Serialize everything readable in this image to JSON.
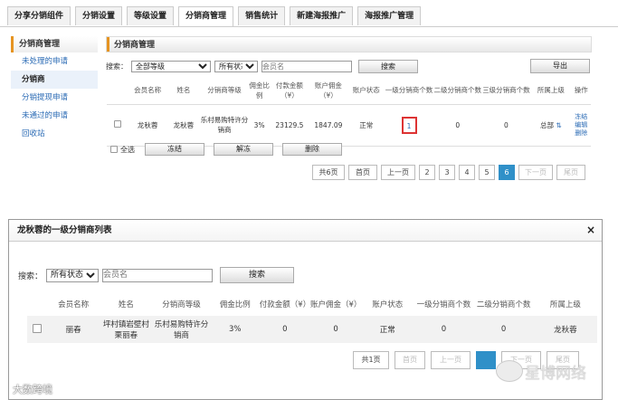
{
  "tabs": [
    "分享分销组件",
    "分销设置",
    "等级设置",
    "分销商管理",
    "销售统计",
    "新建海报推广",
    "海报推广管理"
  ],
  "sidebar": {
    "title": "分销商管理",
    "items": [
      "未处理的申请",
      "分销商",
      "分销提现申请",
      "未通过的申请",
      "回收站"
    ]
  },
  "main": {
    "title": "分销商管理"
  },
  "search": {
    "label": "搜索：",
    "level_value": "全部等级",
    "status_value": "所有状态",
    "member_placeholder": "会员名",
    "search_btn": "搜索",
    "export_btn": "导出"
  },
  "table": {
    "headers": [
      "会员名称",
      "姓名",
      "分销商等级",
      "佣金比例",
      "付款金额（¥）",
      "账户佣金（¥）",
      "账户状态",
      "一级分销商个数",
      "二级分销商个数",
      "三级分销商个数",
      "所属上级",
      "操作"
    ],
    "row": {
      "member": "龙秋蓉",
      "name": "龙秋蓉",
      "level": "乐村易购特许分销商",
      "rate": "3%",
      "pay": "23129.5",
      "commission": "1847.09",
      "status": "正常",
      "l1": "1",
      "l2": "0",
      "l3": "0",
      "parent": "总部",
      "ops": [
        "冻结",
        "编辑",
        "删除"
      ]
    }
  },
  "bulk": {
    "select_all": "全选",
    "freeze": "冻结",
    "unfreeze": "解冻",
    "delete": "删除"
  },
  "pager": {
    "total": "共6页",
    "first": "首页",
    "prev": "上一页",
    "pages": [
      "2",
      "3",
      "4",
      "5",
      "6"
    ],
    "current": "6",
    "next": "下一页",
    "last": "尾页"
  },
  "modal": {
    "title": "龙秋蓉的一级分销商列表",
    "close": "×",
    "search_label": "搜索：",
    "status_value": "所有状态",
    "member_placeholder": "会员名",
    "search_btn": "搜索",
    "headers": [
      "会员名称",
      "姓名",
      "分销商等级",
      "佣金比例",
      "付款金额（¥）",
      "账户佣金（¥）",
      "账户状态",
      "一级分销商个数",
      "二级分销商个数",
      "所属上级"
    ],
    "row": {
      "member": "丽春",
      "name": "坪村镇岩壁村栗丽春",
      "level": "乐村易购特许分销商",
      "rate": "3%",
      "pay": "0",
      "commission": "0",
      "status": "正常",
      "l1": "0",
      "l2": "0",
      "parent": "龙秋蓉"
    },
    "pager": {
      "total": "共1页",
      "first": "首页",
      "prev": "上一页",
      "next": "下一页",
      "last": "尾页"
    }
  },
  "watermarks": {
    "left": "大数跨境",
    "right": "星博网络"
  }
}
